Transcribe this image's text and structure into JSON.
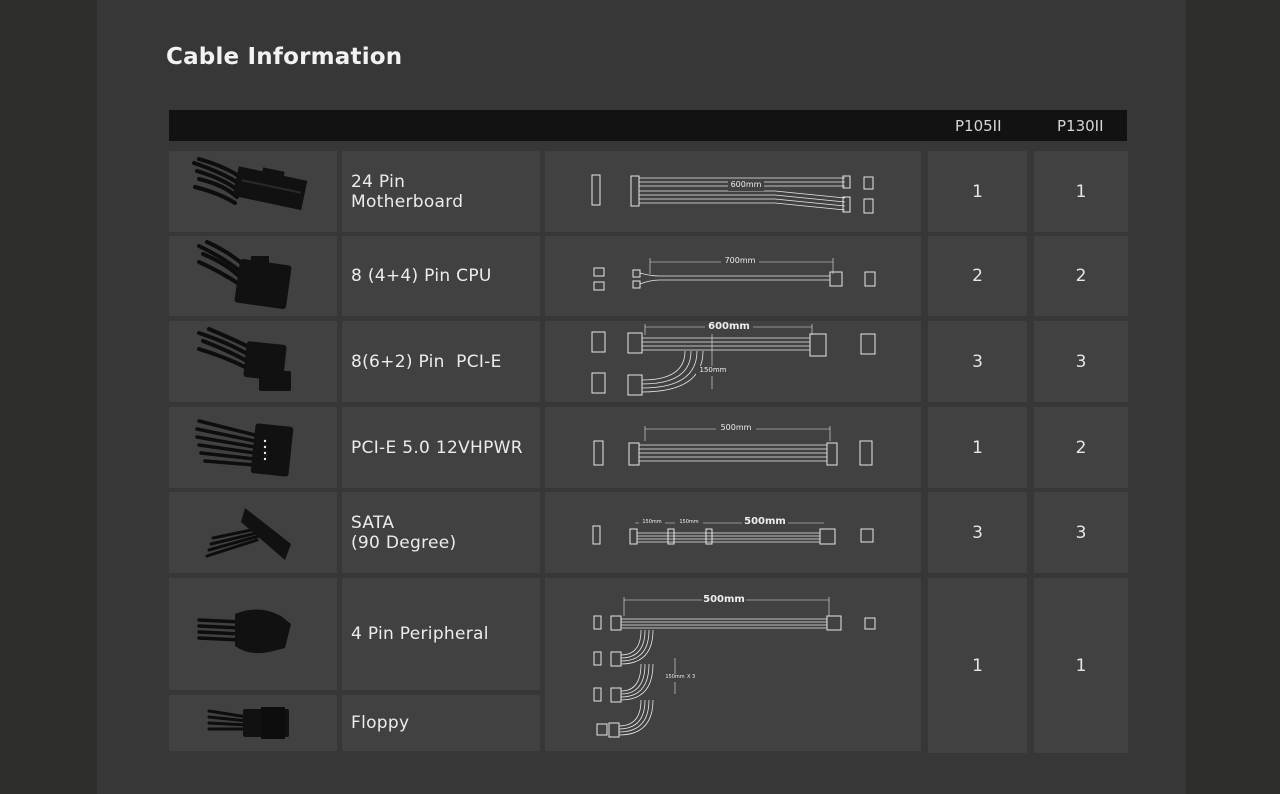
{
  "title": "Cable Information",
  "columns": [
    "P105II",
    "P130II"
  ],
  "rows": [
    {
      "label_lines": [
        "24 Pin",
        "Motherboard"
      ],
      "length": "600mm",
      "p105": "1",
      "p130": "1"
    },
    {
      "label_lines": [
        "8 (4+4) Pin CPU"
      ],
      "length": "700mm",
      "p105": "2",
      "p130": "2"
    },
    {
      "label_lines": [
        "8(6+2) Pin  PCI-E"
      ],
      "length": "600mm",
      "sub_length": "150mm",
      "p105": "3",
      "p130": "3"
    },
    {
      "label_lines": [
        "PCI-E 5.0 12VHPWR"
      ],
      "length": "500mm",
      "p105": "1",
      "p130": "2"
    },
    {
      "label_lines": [
        "SATA",
        "(90 Degree)"
      ],
      "length": "500mm",
      "sub_length_a": "150mm",
      "sub_length_b": "150mm",
      "p105": "3",
      "p130": "3"
    },
    {
      "label_lines": [
        "4 Pin Peripheral"
      ],
      "length": "500mm",
      "sub_length": "150mm",
      "multiplier": "X 3",
      "p105": "1",
      "p130": "1"
    },
    {
      "label_lines": [
        "Floppy"
      ]
    }
  ],
  "icons": [
    "cable-24pin-photo",
    "cable-8pin-cpu-photo",
    "cable-pcie-photo",
    "cable-12vhpwr-photo",
    "cable-sata-photo",
    "cable-molex-photo",
    "cable-floppy-photo"
  ]
}
